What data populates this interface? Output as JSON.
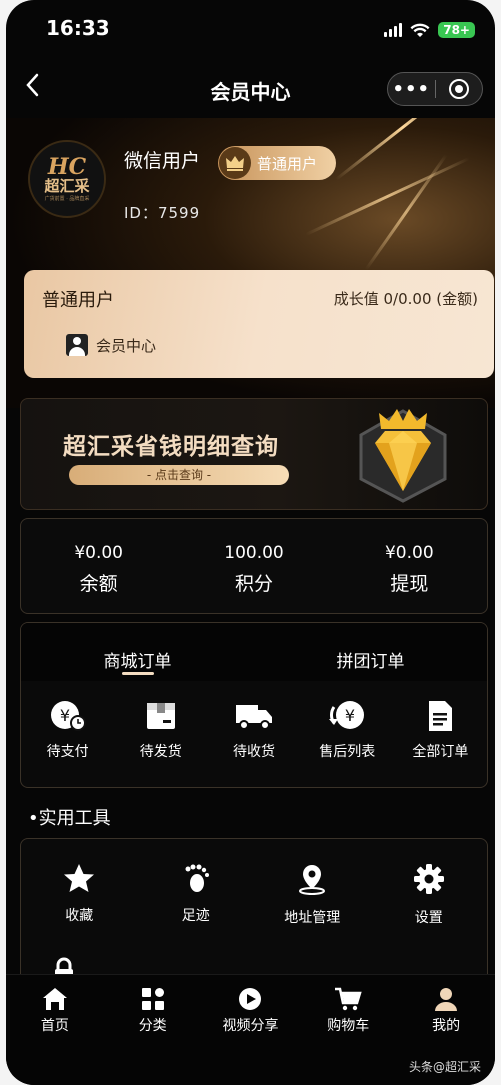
{
  "status_bar": {
    "time": "16:33",
    "battery": "78+"
  },
  "nav": {
    "back_icon": "chevron-left-icon",
    "title": "会员中心",
    "more_icon": "more-dots-icon",
    "close_icon": "target-icon"
  },
  "profile": {
    "logo_monogram": "HC",
    "logo_name": "超汇采",
    "logo_tagline": "广货前置 · 品牌直采",
    "username": "微信用户",
    "level_badge": "普通用户",
    "id_label": "ID：7599"
  },
  "member_card": {
    "level": "普通用户",
    "growth": "成长值 0/0.00 (金额)",
    "link": "会员中心"
  },
  "promo": {
    "title": "超汇采省钱明细查询",
    "button": "- 点击查询 -"
  },
  "wallet": [
    {
      "value": "¥0.00",
      "label": "余额"
    },
    {
      "value": "100.00",
      "label": "积分"
    },
    {
      "value": "¥0.00",
      "label": "提现"
    }
  ],
  "orders": {
    "tabs": [
      "商城订单",
      "拼团订单"
    ],
    "items": [
      {
        "label": "待支付",
        "icon": "yen-clock-icon"
      },
      {
        "label": "待发货",
        "icon": "package-icon"
      },
      {
        "label": "待收货",
        "icon": "truck-icon"
      },
      {
        "label": "售后列表",
        "icon": "yen-return-icon"
      },
      {
        "label": "全部订单",
        "icon": "document-icon"
      }
    ]
  },
  "tools": {
    "title": "•实用工具",
    "items": [
      {
        "label": "收藏",
        "icon": "star-icon"
      },
      {
        "label": "足迹",
        "icon": "footprint-icon"
      },
      {
        "label": "地址管理",
        "icon": "location-pin-icon"
      },
      {
        "label": "设置",
        "icon": "gear-icon"
      }
    ]
  },
  "tabbar": [
    {
      "label": "首页",
      "icon": "home-icon"
    },
    {
      "label": "分类",
      "icon": "category-icon"
    },
    {
      "label": "视频分享",
      "icon": "play-icon"
    },
    {
      "label": "购物车",
      "icon": "cart-icon"
    },
    {
      "label": "我的",
      "icon": "user-icon"
    }
  ],
  "watermark": "头条@超汇采",
  "colors": {
    "gold_light": "#f3dcc1",
    "gold": "#d8ad78",
    "background": "#060606"
  }
}
